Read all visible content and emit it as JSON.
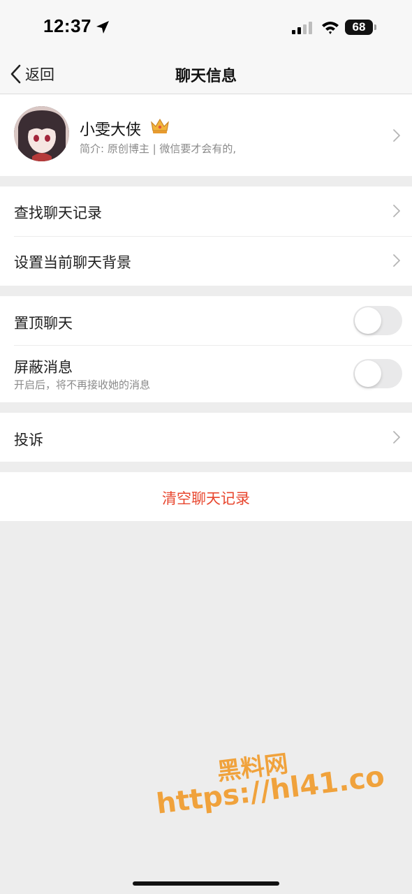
{
  "status_bar": {
    "time": "12:37",
    "battery": "68",
    "icons": [
      "location-arrow-icon",
      "cellular-signal-icon",
      "wifi-icon",
      "battery-icon"
    ]
  },
  "nav": {
    "back_label": "返回",
    "title": "聊天信息"
  },
  "profile": {
    "name": "小雯大侠",
    "bio": "简介: 原创博主 | 微信要才会有的,",
    "badge_icon": "crown-icon"
  },
  "menu1": {
    "search_history": "查找聊天记录",
    "set_background": "设置当前聊天背景"
  },
  "menu2": {
    "pin_chat": {
      "label": "置顶聊天",
      "enabled": false
    },
    "mute": {
      "label": "屏蔽消息",
      "description": "开启后，将不再接收她的消息",
      "enabled": false
    }
  },
  "menu3": {
    "report": "投诉"
  },
  "danger": {
    "clear_history": "清空聊天记录",
    "color": "#e8472f"
  },
  "watermark": {
    "line1": "黑料网",
    "line2": "https://hl41.co",
    "color": "#f0a23c"
  }
}
